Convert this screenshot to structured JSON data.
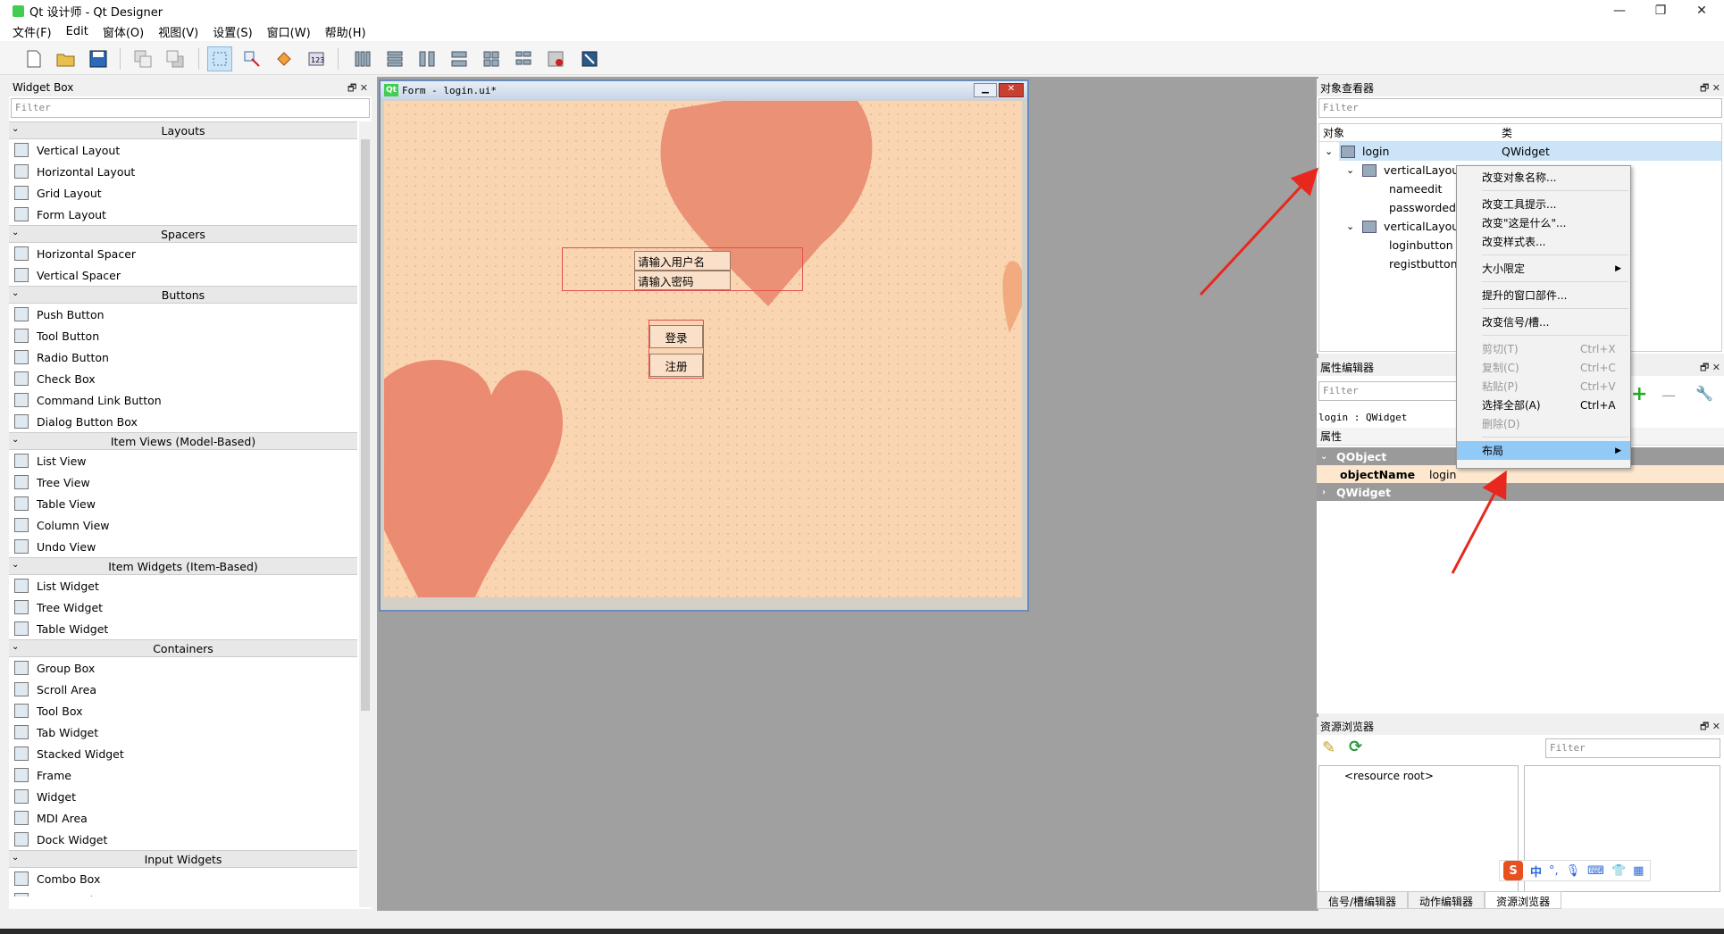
{
  "window": {
    "title": "Qt 设计师 - Qt Designer"
  },
  "menu": [
    "文件(F)",
    "Edit",
    "窗体(O)",
    "视图(V)",
    "设置(S)",
    "窗口(W)",
    "帮助(H)"
  ],
  "widget_box": {
    "title": "Widget Box",
    "filter_placeholder": "Filter",
    "categories": [
      {
        "name": "Layouts",
        "items": [
          "Vertical Layout",
          "Horizontal Layout",
          "Grid Layout",
          "Form Layout"
        ]
      },
      {
        "name": "Spacers",
        "items": [
          "Horizontal Spacer",
          "Vertical Spacer"
        ]
      },
      {
        "name": "Buttons",
        "items": [
          "Push Button",
          "Tool Button",
          "Radio Button",
          "Check Box",
          "Command Link Button",
          "Dialog Button Box"
        ]
      },
      {
        "name": "Item Views (Model-Based)",
        "items": [
          "List View",
          "Tree View",
          "Table View",
          "Column View",
          "Undo View"
        ]
      },
      {
        "name": "Item Widgets (Item-Based)",
        "items": [
          "List Widget",
          "Tree Widget",
          "Table Widget"
        ]
      },
      {
        "name": "Containers",
        "items": [
          "Group Box",
          "Scroll Area",
          "Tool Box",
          "Tab Widget",
          "Stacked Widget",
          "Frame",
          "Widget",
          "MDI Area",
          "Dock Widget"
        ]
      },
      {
        "name": "Input Widgets",
        "items": [
          "Combo Box",
          "Font Combo Box"
        ]
      }
    ]
  },
  "form": {
    "title": "Form - login.ui*",
    "name_field": "请输入用户名",
    "password_field": "请输入密码",
    "login_button": "登录",
    "register_button": "注册"
  },
  "object_inspector": {
    "title": "对象查看器",
    "filter_placeholder": "Filter",
    "col_object": "对象",
    "col_class": "类",
    "rows": [
      {
        "name": "login",
        "class": "QWidget"
      },
      {
        "name": "verticalLayout",
        "class": ""
      },
      {
        "name": "nameedit",
        "class": ""
      },
      {
        "name": "passwordedit",
        "class": ""
      },
      {
        "name": "verticalLayout",
        "class": ""
      },
      {
        "name": "loginbutton",
        "class": ""
      },
      {
        "name": "registbutton",
        "class": ""
      }
    ]
  },
  "context_menu": {
    "items": [
      {
        "label": "改变对象名称...",
        "shortcut": ""
      },
      {
        "label": "改变工具提示...",
        "shortcut": ""
      },
      {
        "label": "改变\"这是什么\"...",
        "shortcut": ""
      },
      {
        "label": "改变样式表...",
        "shortcut": ""
      },
      {
        "label": "大小限定",
        "shortcut": ""
      },
      {
        "label": "提升的窗口部件...",
        "shortcut": ""
      },
      {
        "label": "改变信号/槽...",
        "shortcut": ""
      },
      {
        "label": "剪切(T)",
        "shortcut": "Ctrl+X"
      },
      {
        "label": "复制(C)",
        "shortcut": "Ctrl+C"
      },
      {
        "label": "粘贴(P)",
        "shortcut": "Ctrl+V"
      },
      {
        "label": "选择全部(A)",
        "shortcut": "Ctrl+A"
      },
      {
        "label": "删除(D)",
        "shortcut": ""
      },
      {
        "label": "布局",
        "shortcut": ""
      }
    ]
  },
  "property_editor": {
    "title": "属性编辑器",
    "filter_placeholder": "Filter",
    "context": "login : QWidget",
    "col_property": "属性",
    "group1": "QObject",
    "prop_name": "objectName",
    "prop_value": "login",
    "group2": "QWidget"
  },
  "resource_browser": {
    "title": "资源浏览器",
    "filter_placeholder": "Filter",
    "root": "<resource root>"
  },
  "bottom_tabs": [
    "信号/槽编辑器",
    "动作编辑器",
    "资源浏览器"
  ],
  "ime_bar": [
    "中",
    "°,"
  ]
}
